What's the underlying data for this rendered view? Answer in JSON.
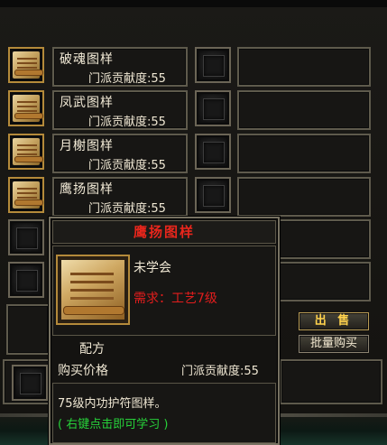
{
  "recipes": [
    {
      "name": "破魂图样",
      "contrib": "门派贡献度:55"
    },
    {
      "name": "凤武图样",
      "contrib": "门派贡献度:55"
    },
    {
      "name": "月榭图样",
      "contrib": "门派贡献度:55"
    },
    {
      "name": "鹰扬图样",
      "contrib": "门派贡献度:55"
    }
  ],
  "buttons": {
    "sell": "出 售",
    "bulk_buy": "批量购买"
  },
  "tooltip": {
    "title": "鹰扬图样",
    "status": "未学会",
    "requirement": "需求：工艺7级",
    "type": "配方",
    "price_label": "购买价格",
    "price_value": "门派贡献度:55",
    "description": "75级内功护符图样。",
    "hint": "( 右键点击即可学习 )"
  },
  "colors": {
    "title_red": "#e8261c",
    "requirement_red": "#e21d1d",
    "hint_green": "#27d23a",
    "sell_gold": "#ffd24d"
  }
}
